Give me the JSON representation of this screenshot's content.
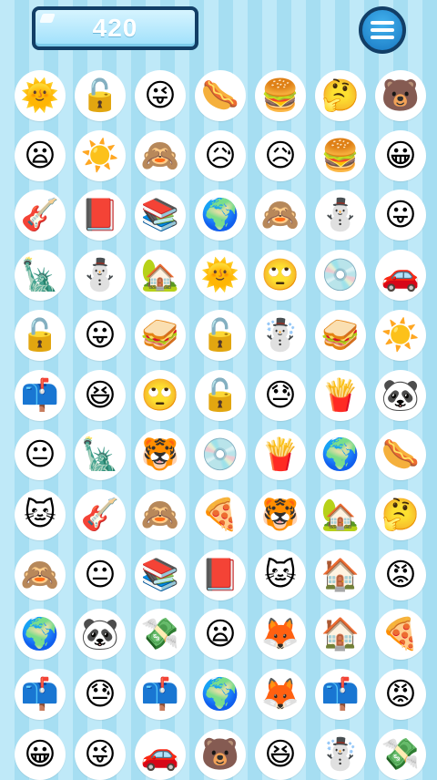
{
  "score": "420",
  "menu_icon": "hamburger-menu-icon",
  "board": {
    "rows": [
      [
        {
          "name": "sun-with-face",
          "glyph": "🌞"
        },
        {
          "name": "unlocked-padlock",
          "glyph": "🔓"
        },
        {
          "name": "winking-tongue-face",
          "glyph": "😜"
        },
        {
          "name": "hot-dog",
          "glyph": "🌭"
        },
        {
          "name": "hamburger",
          "glyph": "🍔"
        },
        {
          "name": "thinking-face",
          "glyph": "🤔"
        },
        {
          "name": "bear-face",
          "glyph": "🐻"
        }
      ],
      [
        {
          "name": "frowning-face",
          "glyph": "😦"
        },
        {
          "name": "sun",
          "glyph": "☀️"
        },
        {
          "name": "see-no-evil-monkey",
          "glyph": "🙈"
        },
        {
          "name": "sad-sweat-face",
          "glyph": "😥"
        },
        {
          "name": "sad-sweat-face",
          "glyph": "😥"
        },
        {
          "name": "hamburger",
          "glyph": "🍔"
        },
        {
          "name": "grinning-face",
          "glyph": "😀"
        }
      ],
      [
        {
          "name": "guitar",
          "glyph": "🎸"
        },
        {
          "name": "red-book",
          "glyph": "📕"
        },
        {
          "name": "books",
          "glyph": "📚"
        },
        {
          "name": "globe",
          "glyph": "🌍"
        },
        {
          "name": "see-no-evil-monkey",
          "glyph": "🙈"
        },
        {
          "name": "snowman",
          "glyph": "⛄"
        },
        {
          "name": "tongue-face",
          "glyph": "😛"
        }
      ],
      [
        {
          "name": "statue-of-liberty",
          "glyph": "🗽"
        },
        {
          "name": "snowman",
          "glyph": "⛄"
        },
        {
          "name": "house-with-garden",
          "glyph": "🏡"
        },
        {
          "name": "sun-with-face",
          "glyph": "🌞"
        },
        {
          "name": "eye-roll-face",
          "glyph": "🙄"
        },
        {
          "name": "cd-disc",
          "glyph": "💿"
        },
        {
          "name": "red-car",
          "glyph": "🚗"
        }
      ],
      [
        {
          "name": "unlocked-padlock",
          "glyph": "🔓"
        },
        {
          "name": "tongue-face",
          "glyph": "😛"
        },
        {
          "name": "sandwich",
          "glyph": "🥪"
        },
        {
          "name": "unlocked-padlock",
          "glyph": "🔓"
        },
        {
          "name": "snowman-with-snow",
          "glyph": "☃️"
        },
        {
          "name": "sandwich",
          "glyph": "🥪"
        },
        {
          "name": "sun",
          "glyph": "☀️"
        }
      ],
      [
        {
          "name": "mailbox",
          "glyph": "📫"
        },
        {
          "name": "laughing-face",
          "glyph": "😆"
        },
        {
          "name": "eye-roll-face",
          "glyph": "🙄"
        },
        {
          "name": "unlocked-padlock",
          "glyph": "🔓"
        },
        {
          "name": "downcast-sweat-face",
          "glyph": "😓"
        },
        {
          "name": "french-fries",
          "glyph": "🍟"
        },
        {
          "name": "panda",
          "glyph": "🐼"
        }
      ],
      [
        {
          "name": "neutral-face",
          "glyph": "😐"
        },
        {
          "name": "statue-of-liberty",
          "glyph": "🗽"
        },
        {
          "name": "tiger-face",
          "glyph": "🐯"
        },
        {
          "name": "cd-disc",
          "glyph": "💿"
        },
        {
          "name": "french-fries",
          "glyph": "🍟"
        },
        {
          "name": "globe",
          "glyph": "🌍"
        },
        {
          "name": "hot-dog",
          "glyph": "🌭"
        }
      ],
      [
        {
          "name": "cat-face",
          "glyph": "🐱"
        },
        {
          "name": "guitar",
          "glyph": "🎸"
        },
        {
          "name": "see-no-evil-monkey",
          "glyph": "🙈"
        },
        {
          "name": "pizza",
          "glyph": "🍕"
        },
        {
          "name": "tiger-face",
          "glyph": "🐯"
        },
        {
          "name": "house-with-garden",
          "glyph": "🏡"
        },
        {
          "name": "thinking-face",
          "glyph": "🤔"
        }
      ],
      [
        {
          "name": "see-no-evil-monkey",
          "glyph": "🙈"
        },
        {
          "name": "neutral-face",
          "glyph": "😐"
        },
        {
          "name": "books",
          "glyph": "📚"
        },
        {
          "name": "red-book",
          "glyph": "📕"
        },
        {
          "name": "cat-face",
          "glyph": "🐱"
        },
        {
          "name": "house",
          "glyph": "🏠"
        },
        {
          "name": "angry-face",
          "glyph": "😡"
        }
      ],
      [
        {
          "name": "globe",
          "glyph": "🌍"
        },
        {
          "name": "panda",
          "glyph": "🐼"
        },
        {
          "name": "money-with-wings",
          "glyph": "💸"
        },
        {
          "name": "frowning-face",
          "glyph": "😦"
        },
        {
          "name": "fox-face",
          "glyph": "🦊"
        },
        {
          "name": "house",
          "glyph": "🏠"
        },
        {
          "name": "pizza",
          "glyph": "🍕"
        }
      ],
      [
        {
          "name": "mailbox",
          "glyph": "📫"
        },
        {
          "name": "downcast-sweat-face",
          "glyph": "😓"
        },
        {
          "name": "mailbox",
          "glyph": "📫"
        },
        {
          "name": "globe",
          "glyph": "🌍"
        },
        {
          "name": "fox-face",
          "glyph": "🦊"
        },
        {
          "name": "mailbox",
          "glyph": "📫"
        },
        {
          "name": "angry-face",
          "glyph": "😡"
        }
      ],
      [
        {
          "name": "grinning-face",
          "glyph": "😀"
        },
        {
          "name": "winking-tongue-face",
          "glyph": "😜"
        },
        {
          "name": "red-car",
          "glyph": "🚗"
        },
        {
          "name": "bear-face",
          "glyph": "🐻"
        },
        {
          "name": "laughing-face",
          "glyph": "😆"
        },
        {
          "name": "snowman-with-snow",
          "glyph": "☃️"
        },
        {
          "name": "money-with-wings",
          "glyph": "💸"
        }
      ]
    ]
  }
}
